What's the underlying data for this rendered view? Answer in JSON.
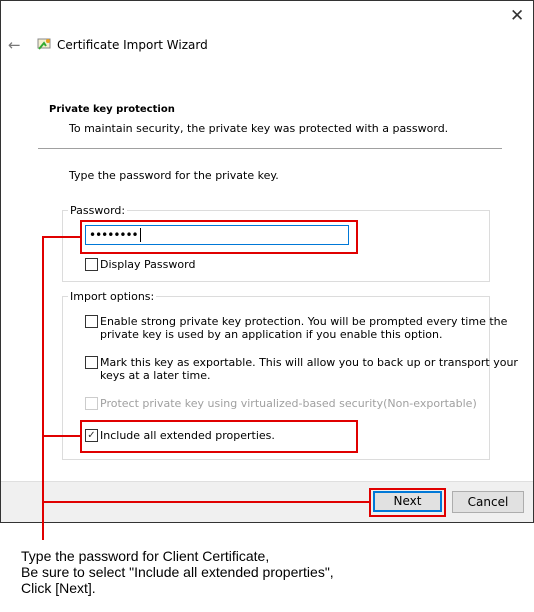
{
  "window": {
    "title": "Certificate Import Wizard",
    "close_icon": "close-icon",
    "back_icon": "arrow-left-icon",
    "app_icon": "certificate-icon"
  },
  "header": {
    "title": "Private key protection",
    "subtitle": "To maintain security, the private key was protected with a password."
  },
  "instruction": "Type the password for the private key.",
  "password_group": {
    "label": "Password:",
    "value": "••••••••",
    "display_password": {
      "label": "Display Password",
      "checked": false
    }
  },
  "import_options": {
    "label": "Import options:",
    "options": [
      {
        "line1": "Enable strong private key protection. You will be prompted every time the",
        "line2": "private key is used by an application if you enable this option.",
        "checked": false,
        "enabled": true
      },
      {
        "line1": "Mark this key as exportable. This will allow you to back up or transport your",
        "line2": "keys at a later time.",
        "checked": false,
        "enabled": true
      },
      {
        "line1": "Protect private key using virtualized-based security(Non-exportable)",
        "checked": false,
        "enabled": false
      },
      {
        "line1": "Include all extended properties.",
        "checked": true,
        "enabled": true
      }
    ]
  },
  "buttons": {
    "next": "Next",
    "cancel": "Cancel"
  },
  "annotation": {
    "line1": "Type the password for Client Certificate,",
    "line2": "Be sure to select \"Include all extended properties\",",
    "line3": "Click [Next].",
    "highlight_color": "#e00000"
  }
}
